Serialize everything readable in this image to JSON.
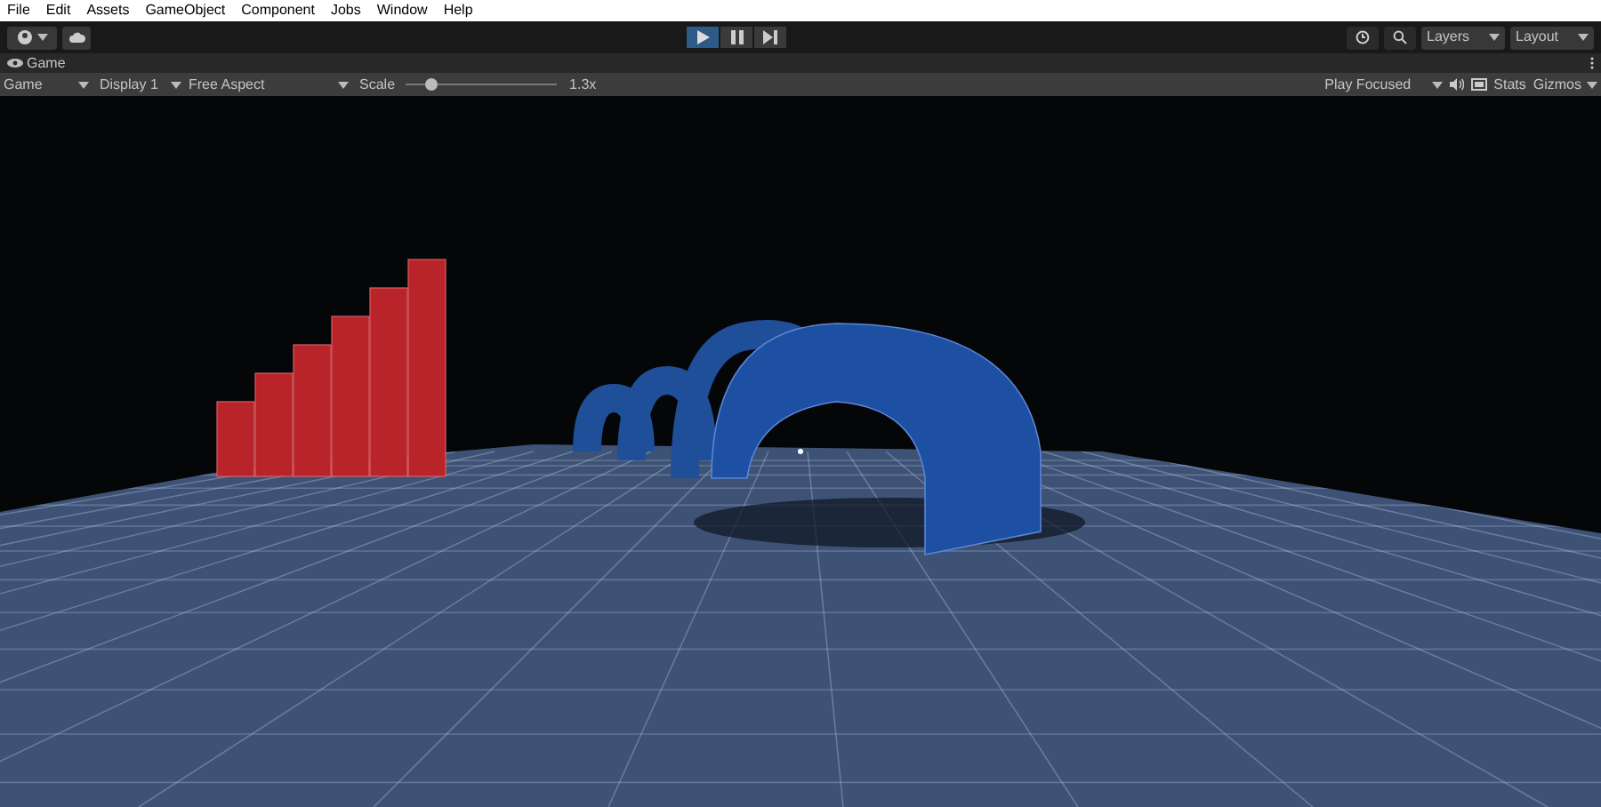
{
  "menu_bar": {
    "items": [
      "File",
      "Edit",
      "Assets",
      "GameObject",
      "Component",
      "Jobs",
      "Window",
      "Help"
    ]
  },
  "toolbar": {
    "play_controls": [
      {
        "kind": "play",
        "selected": true
      },
      {
        "kind": "pause",
        "selected": false
      },
      {
        "kind": "step",
        "selected": false
      }
    ],
    "layers_dropdown": "Layers",
    "layout_dropdown": "Layout"
  },
  "tab": {
    "label": "Game"
  },
  "game_bar": {
    "view_dropdown": "Game",
    "display_dropdown": "Display 1",
    "aspect_dropdown": "Free Aspect",
    "scale_label": "Scale",
    "scale": {
      "level": 0.17
    },
    "scale_value": "1.3x",
    "play_mode_dropdown": "Play Focused",
    "stats_button": "Stats",
    "gizmos_button": "Gizmos"
  }
}
